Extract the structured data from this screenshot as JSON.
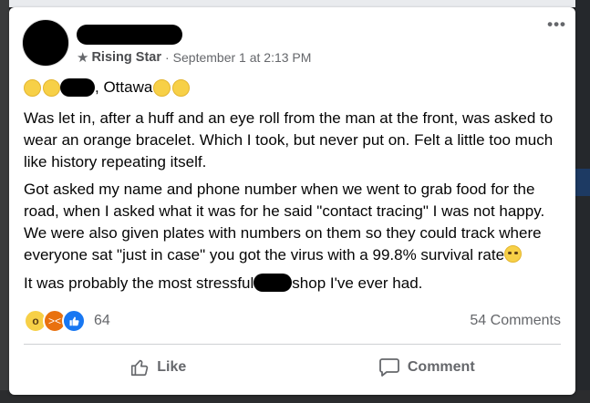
{
  "post": {
    "badge": "Rising Star",
    "timestamp": "September 1 at 2:13 PM",
    "separator": "·",
    "more": "•••",
    "location_text": ", Ottawa",
    "paragraphs": {
      "p1": "Was let in, after a huff and an eye roll from the man at the front, was asked to wear an orange bracelet. Which I took, but never put on. Felt a little too much like history repeating itself.",
      "p2": "Got asked my name and phone number when we went to grab food for the road, when I asked what it was for he said \"contact tracing\" I was not happy. We were also given plates with numbers on them so they could track where everyone sat \"just in case\" you got the virus with a 99.8% survival rate",
      "p3_before": "It was probably the most stressful",
      "p3_after": "shop I've ever had."
    },
    "reaction_count": "64",
    "comment_count": "54 Comments",
    "actions": {
      "like": "Like",
      "comment": "Comment"
    }
  },
  "icons": [
    "more-icon",
    "star-icon",
    "like-icon",
    "comment-icon"
  ],
  "colors": {
    "background": "#ffffff",
    "meta_text": "#65676b",
    "like_blue": "#1877f2"
  }
}
